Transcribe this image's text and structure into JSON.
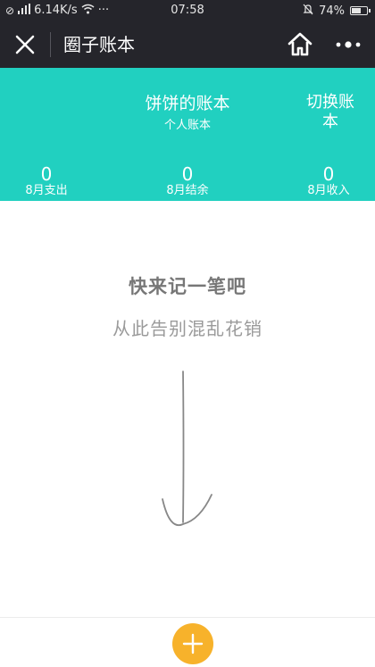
{
  "status_bar": {
    "network_speed": "6.14K/s",
    "time": "07:58",
    "battery": "74%",
    "battery_level": 0.74,
    "more": "···"
  },
  "title_bar": {
    "title": "圈子账本"
  },
  "header": {
    "book_title": "饼饼的账本",
    "book_subtitle": "个人账本",
    "switch_label": "切换账本",
    "stats": [
      {
        "value": "0",
        "label": "8月支出"
      },
      {
        "value": "0",
        "label": "8月结余"
      },
      {
        "value": "0",
        "label": "8月收入"
      }
    ]
  },
  "empty_state": {
    "title": "快来记一笔吧",
    "subtitle": "从此告别混乱花销"
  },
  "colors": {
    "header_bg": "#21d0c0",
    "titlebar_bg": "#25252b",
    "add_button": "#f7b22b"
  }
}
